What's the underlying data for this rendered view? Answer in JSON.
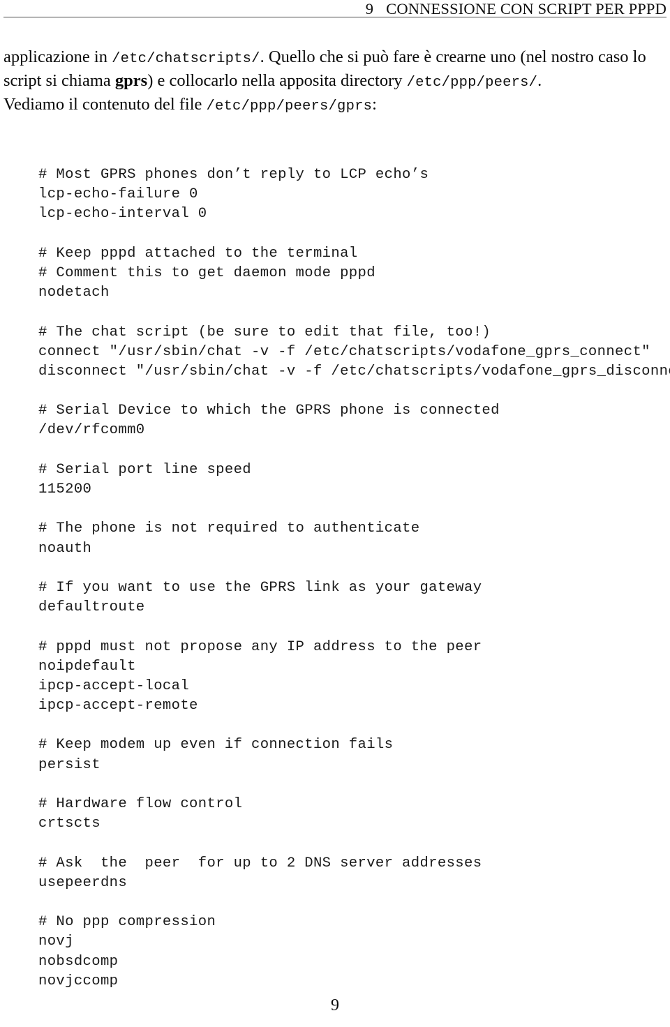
{
  "header": {
    "section_number": "9",
    "section_title": "CONNESSIONE CON SCRIPT PER PPPD"
  },
  "body": {
    "line1_a": "applicazione in ",
    "line1_code": "/etc/chatscripts/",
    "line1_b": ". Quello che si può fare è crearne uno (nel nostro caso lo",
    "line2_a": "script si chiama ",
    "line2_bold": "gprs",
    "line2_b": ") e collocarlo nella apposita directory ",
    "line2_code": "/etc/ppp/peers/",
    "line2_c": ".",
    "line3_a": "Vediamo il contenuto del file ",
    "line3_code": "/etc/ppp/peers/gprs",
    "line3_b": ":"
  },
  "code_block": {
    "title": "/etc/ppp/peers/gprs",
    "lines": [
      "# Most GPRS phones don’t reply to LCP echo’s",
      "lcp-echo-failure 0",
      "lcp-echo-interval 0",
      "",
      "# Keep pppd attached to the terminal",
      "# Comment this to get daemon mode pppd",
      "nodetach",
      "",
      "# The chat script (be sure to edit that file, too!)",
      "connect \"/usr/sbin/chat -v -f /etc/chatscripts/vodafone_gprs_connect\"",
      "disconnect \"/usr/sbin/chat -v -f /etc/chatscripts/vodafone_gprs_disconnect\"",
      "",
      "# Serial Device to which the GPRS phone is connected",
      "/dev/rfcomm0",
      "",
      "# Serial port line speed",
      "115200",
      "",
      "# The phone is not required to authenticate",
      "noauth",
      "",
      "# If you want to use the GPRS link as your gateway",
      "defaultroute",
      "",
      "# pppd must not propose any IP address to the peer",
      "noipdefault",
      "ipcp-accept-local",
      "ipcp-accept-remote",
      "",
      "# Keep modem up even if connection fails",
      "persist",
      "",
      "# Hardware flow control",
      "crtscts",
      "",
      "# Ask  the  peer  for up to 2 DNS server addresses",
      "usepeerdns",
      "",
      "# No ppp compression",
      "novj",
      "nobsdcomp",
      "novjccomp"
    ]
  },
  "footer": {
    "page_number": "9"
  }
}
